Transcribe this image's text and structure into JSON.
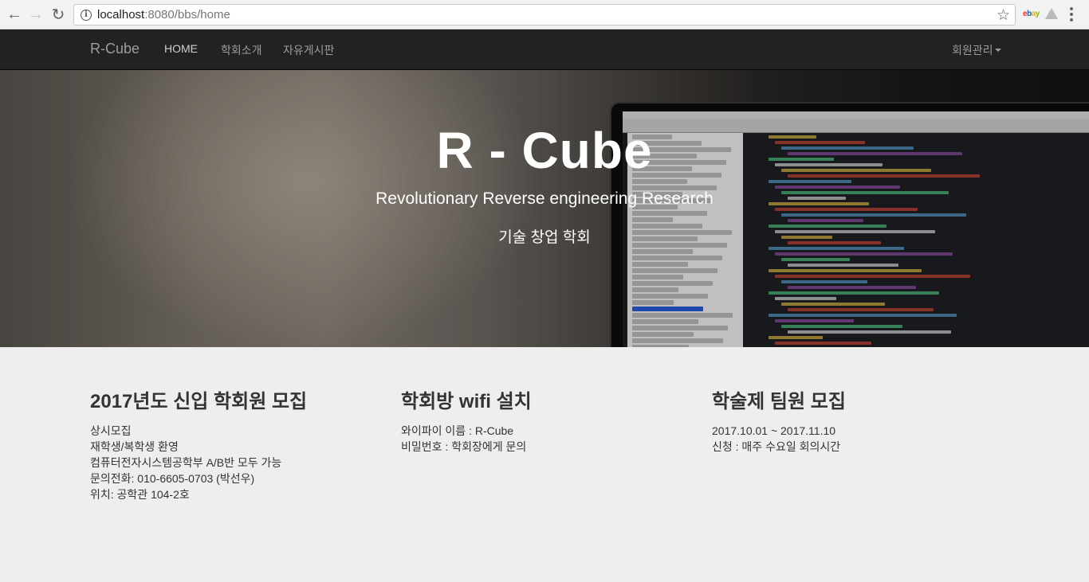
{
  "browser": {
    "url_host": "localhost",
    "url_path": ":8080/bbs/home",
    "extensions": [
      "ebay-icon",
      "triangle-extension-icon"
    ]
  },
  "navbar": {
    "brand": "R-Cube",
    "links": [
      "HOME",
      "학회소개",
      "자유게시판"
    ],
    "dropdown": "회원관리"
  },
  "hero": {
    "title": "R - Cube",
    "subtitle": "Revolutionary Reverse engineering Research",
    "tagline": "기술 창업 학회"
  },
  "columns": [
    {
      "heading": "2017년도 신입 학회원 모집",
      "lines": [
        "상시모집",
        "재학생/복학생 환영",
        "컴퓨터전자시스템공학부 A/B반 모두 가능",
        "문의전화: 010-6605-0703 (박선우)",
        "위치: 공학관 104-2호"
      ]
    },
    {
      "heading": "학회방 wifi 설치",
      "lines": [
        "와이파이 이름 : R-Cube",
        "비밀번호 : 학회장에게 문의"
      ]
    },
    {
      "heading": "학술제 팀원 모집",
      "lines": [
        "2017.10.01 ~ 2017.11.10",
        "신청 : 매주 수요일 회의시간"
      ]
    }
  ]
}
